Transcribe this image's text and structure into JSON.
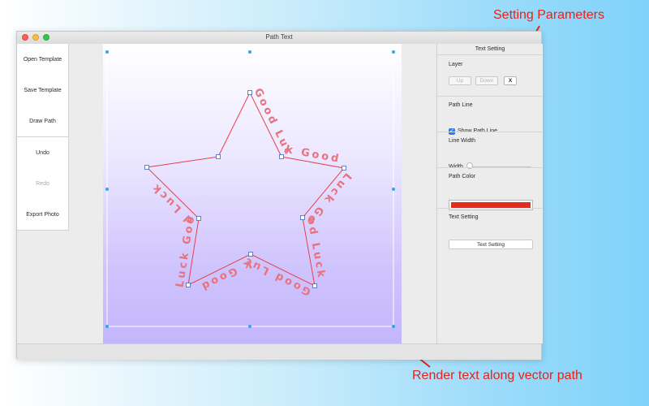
{
  "annotations": {
    "top": "Setting Parameters",
    "bottom": "Render text along vector path",
    "color": "#e8211a"
  },
  "window": {
    "title": "Path Text",
    "traffic_lights": [
      "close",
      "minimize",
      "maximize"
    ]
  },
  "sidebar": {
    "buttons": [
      {
        "label": "Open Template",
        "enabled": true
      },
      {
        "label": "Save Template",
        "enabled": true
      },
      {
        "label": "Draw Path",
        "enabled": true
      },
      {
        "label": "Undo",
        "enabled": true
      },
      {
        "label": "Redo",
        "enabled": false
      },
      {
        "label": "Export Photo",
        "enabled": true
      }
    ]
  },
  "canvas": {
    "path_text": "Good Luck ",
    "path_color": "#e8404a",
    "text_color": "#e8727e",
    "handle_color": "#2aa7f0"
  },
  "panel": {
    "header": "Text Setting",
    "layer": {
      "title": "Layer",
      "up": "Up",
      "down": "Down",
      "remove": "X"
    },
    "path_line": {
      "title": "Path Line",
      "show_label": "Show Path Line",
      "checked": true
    },
    "line_width": {
      "title": "Line Width",
      "width_label": "Width",
      "value": 0.0
    },
    "path_color": {
      "title": "Path Color",
      "color": "#e52b1c"
    },
    "text_setting": {
      "title": "Text Setting",
      "button": "Text Setting"
    }
  }
}
